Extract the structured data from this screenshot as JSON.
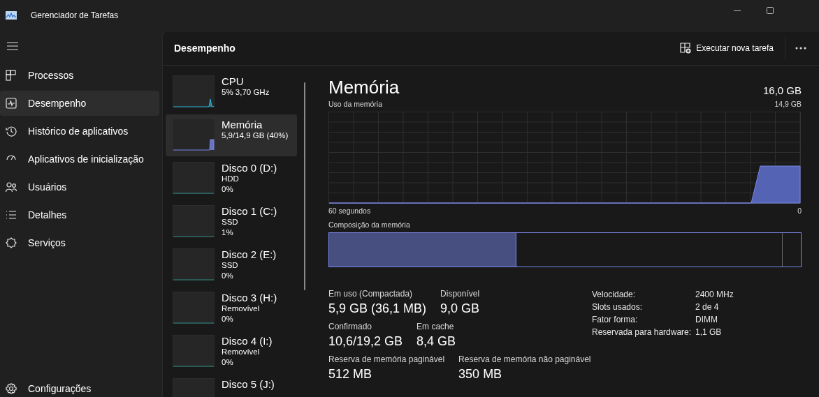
{
  "window": {
    "title": "Gerenciador de Tarefas"
  },
  "sidebar": {
    "items": [
      {
        "label": "Processos",
        "selected": false
      },
      {
        "label": "Desempenho",
        "selected": true
      },
      {
        "label": "Histórico de aplicativos",
        "selected": false
      },
      {
        "label": "Aplicativos de inicialização",
        "selected": false
      },
      {
        "label": "Usuários",
        "selected": false
      },
      {
        "label": "Detalhes",
        "selected": false
      },
      {
        "label": "Serviços",
        "selected": false
      }
    ],
    "settings": "Configurações"
  },
  "header": {
    "title": "Desempenho",
    "run_task": "Executar nova tarefa"
  },
  "devices": [
    {
      "kind": "cpu",
      "name": "CPU",
      "lines": [
        "5% 3,70 GHz"
      ],
      "selected": false
    },
    {
      "kind": "memory",
      "name": "Memória",
      "lines": [
        "5,9/14,9 GB (40%)"
      ],
      "selected": true
    },
    {
      "kind": "disk",
      "name": "Disco 0 (D:)",
      "lines": [
        "HDD",
        "0%"
      ],
      "selected": false
    },
    {
      "kind": "disk",
      "name": "Disco 1 (C:)",
      "lines": [
        "SSD",
        "1%"
      ],
      "selected": false
    },
    {
      "kind": "disk",
      "name": "Disco 2 (E:)",
      "lines": [
        "SSD",
        "0%"
      ],
      "selected": false
    },
    {
      "kind": "disk",
      "name": "Disco 3 (H:)",
      "lines": [
        "Removível",
        "0%"
      ],
      "selected": false
    },
    {
      "kind": "disk",
      "name": "Disco 4 (I:)",
      "lines": [
        "Removível",
        "0%"
      ],
      "selected": false
    },
    {
      "kind": "disk",
      "name": "Disco 5 (J:)",
      "selected": false
    }
  ],
  "detail": {
    "title": "Memória",
    "total": "16,0 GB",
    "usage_label": "Uso da memória",
    "usage_max": "14,9 GB",
    "time_span": "60 segundos",
    "time_end": "0",
    "composition_label": "Composição da memória",
    "stats": [
      [
        {
          "label": "Em uso (Compactada)",
          "value": "5,9 GB (36,1 MB)"
        },
        {
          "label": "Disponível",
          "value": "9,0 GB"
        }
      ],
      [
        {
          "label": "Confirmado",
          "value": "10,6/19,2 GB"
        },
        {
          "label": "Em cache",
          "value": "8,4 GB"
        }
      ],
      [
        {
          "label": "Reserva de memória paginável",
          "value": "512 MB"
        },
        {
          "label": "Reserva de memória não paginável",
          "value": "350 MB"
        }
      ]
    ],
    "specs": [
      {
        "label": "Velocidade:",
        "value": "2400 MHz"
      },
      {
        "label": "Slots usados:",
        "value": "2 de 4"
      },
      {
        "label": "Fator forma:",
        "value": "DIMM"
      },
      {
        "label": "Reservada para hardware:",
        "value": "1,1 GB"
      }
    ]
  }
}
